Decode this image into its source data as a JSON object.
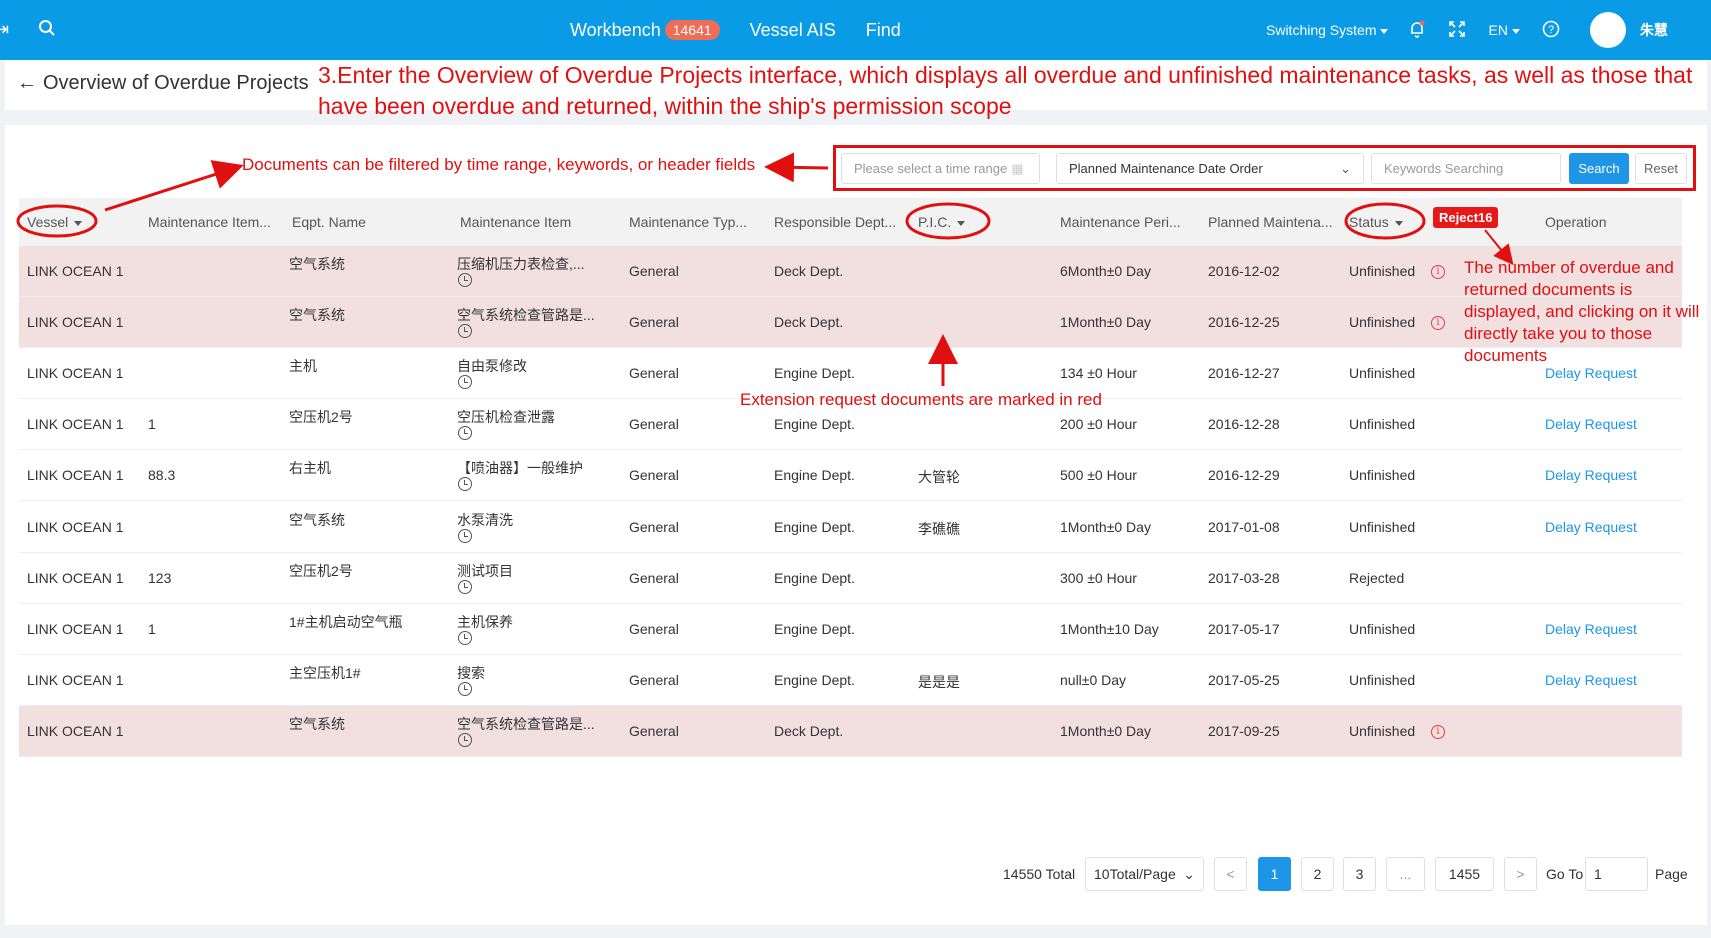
{
  "topbar": {
    "tabs": [
      {
        "label": "Workbench",
        "badge": "14641"
      },
      {
        "label": "Vessel AIS"
      },
      {
        "label": "Find"
      }
    ],
    "switch_system": "Switching System",
    "language": "EN",
    "user_name": "朱慧",
    "bg_color": "#0a9be6"
  },
  "header": {
    "back_icon": "←",
    "title": "Overview of Overdue Projects"
  },
  "annotations": {
    "title": "3.Enter the Overview of Overdue Projects interface, which displays all overdue and unfinished maintenance tasks, as well as those that have been overdue and returned, within the ship's permission scope",
    "filter": "Documents can be filtered by time range, keywords, or header fields",
    "extension": "Extension request documents are marked in red",
    "reject_tag": "Reject16",
    "reject_note": "The number of overdue and returned documents is displayed, and clicking on it will directly take you to those documents",
    "color": "#e01010"
  },
  "filters": {
    "date_placeholder": "Please select a time range",
    "order_select": "Planned Maintenance Date Order",
    "keyword_placeholder": "Keywords Searching",
    "search_label": "Search",
    "reset_label": "Reset"
  },
  "table": {
    "columns": [
      "Vessel",
      "Maintenance Item...",
      "Eqpt. Name",
      "Maintenance Item",
      "Maintenance Typ...",
      "Responsible Dept...",
      "P.I.C.",
      "Maintenance Peri...",
      "Planned Maintena...",
      "Status",
      "Operation"
    ],
    "rows": [
      {
        "vessel": "LINK OCEAN 1",
        "code": "",
        "eqpt": "空气系统",
        "item": "压缩机压力表检查,...",
        "type": "General",
        "dept": "Deck Dept.",
        "pic": "",
        "period": "6Month±0 Day",
        "date": "2016-12-02",
        "status": "Unfinished",
        "op": "",
        "extension": true
      },
      {
        "vessel": "LINK OCEAN 1",
        "code": "",
        "eqpt": "空气系统",
        "item": "空气系统检查管路是...",
        "type": "General",
        "dept": "Deck Dept.",
        "pic": "",
        "period": "1Month±0 Day",
        "date": "2016-12-25",
        "status": "Unfinished",
        "op": "",
        "extension": true
      },
      {
        "vessel": "LINK OCEAN 1",
        "code": "",
        "eqpt": "主机",
        "item": "自由泵修改",
        "type": "General",
        "dept": "Engine Dept.",
        "pic": "",
        "period": "134 ±0 Hour",
        "date": "2016-12-27",
        "status": "Unfinished",
        "op": "Delay Request",
        "extension": false
      },
      {
        "vessel": "LINK OCEAN 1",
        "code": "1",
        "eqpt": "空压机2号",
        "item": "空压机检查泄露",
        "type": "General",
        "dept": "Engine Dept.",
        "pic": "",
        "period": "200 ±0 Hour",
        "date": "2016-12-28",
        "status": "Unfinished",
        "op": "Delay Request",
        "extension": false
      },
      {
        "vessel": "LINK OCEAN 1",
        "code": "88.3",
        "eqpt": "右主机",
        "item": "【喷油器】一般维护",
        "type": "General",
        "dept": "Engine Dept.",
        "pic": "大管轮",
        "period": "500 ±0 Hour",
        "date": "2016-12-29",
        "status": "Unfinished",
        "op": "Delay Request",
        "extension": false
      },
      {
        "vessel": "LINK OCEAN 1",
        "code": "",
        "eqpt": "空气系统",
        "item": "水泵清洗",
        "type": "General",
        "dept": "Engine Dept.",
        "pic": "李礁礁",
        "period": "1Month±0 Day",
        "date": "2017-01-08",
        "status": "Unfinished",
        "op": "Delay Request",
        "extension": false
      },
      {
        "vessel": "LINK OCEAN 1",
        "code": "123",
        "eqpt": "空压机2号",
        "item": "测试项目",
        "type": "General",
        "dept": "Engine Dept.",
        "pic": "",
        "period": "300 ±0 Hour",
        "date": "2017-03-28",
        "status": "Rejected",
        "op": "",
        "extension": false
      },
      {
        "vessel": "LINK OCEAN 1",
        "code": "1",
        "eqpt": "1#主机启动空气瓶",
        "item": "主机保养",
        "type": "General",
        "dept": "Engine Dept.",
        "pic": "",
        "period": "1Month±10 Day",
        "date": "2017-05-17",
        "status": "Unfinished",
        "op": "Delay Request",
        "extension": false
      },
      {
        "vessel": "LINK OCEAN 1",
        "code": "",
        "eqpt": "主空压机1#",
        "item": "搜索",
        "type": "General",
        "dept": "Engine Dept.",
        "pic": "是是是",
        "period": "null±0 Day",
        "date": "2017-05-25",
        "status": "Unfinished",
        "op": "Delay Request",
        "extension": false
      },
      {
        "vessel": "LINK OCEAN 1",
        "code": "",
        "eqpt": "空气系统",
        "item": "空气系统检查管路是...",
        "type": "General",
        "dept": "Deck Dept.",
        "pic": "",
        "period": "1Month±0 Day",
        "date": "2017-09-25",
        "status": "Unfinished",
        "op": "",
        "extension": true
      }
    ],
    "extension_row_color": "#f2dfe0"
  },
  "pagination": {
    "total": "14550 Total",
    "page_size": "10Total/Page",
    "prev": "<",
    "pages": [
      "1",
      "2",
      "3",
      "...",
      "1455"
    ],
    "next": ">",
    "goto_label": "Go To",
    "goto_value": "1",
    "page_label": "Page",
    "active_color": "#1e95e6"
  }
}
